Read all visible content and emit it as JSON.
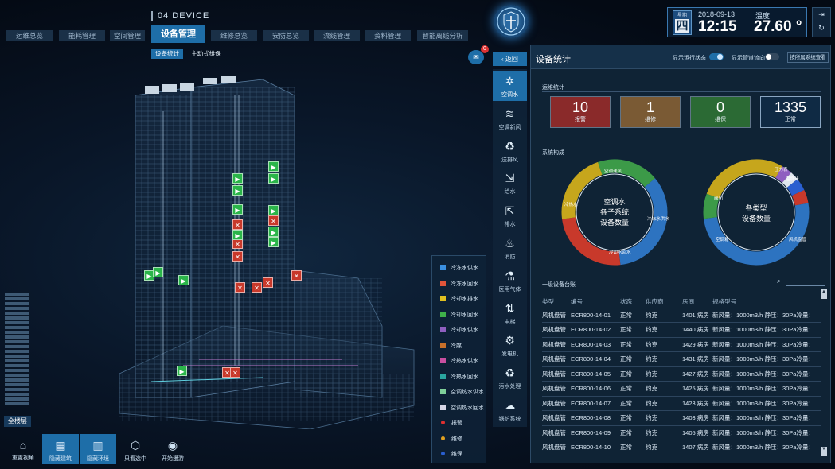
{
  "device_title": "04 DEVICE",
  "nav": [
    {
      "label": "运维总览",
      "active": false
    },
    {
      "label": "能耗管理",
      "active": false
    },
    {
      "label": "空间管理",
      "active": false
    },
    {
      "label": "设备管理",
      "active": true
    },
    {
      "label": "维修总览",
      "active": false
    },
    {
      "label": "安防总览",
      "active": false
    },
    {
      "label": "流线管理",
      "active": false
    },
    {
      "label": "资料管理",
      "active": false
    },
    {
      "label": "智能离线分析",
      "active": false
    }
  ],
  "subtabs": [
    {
      "label": "设备统计",
      "active": true
    },
    {
      "label": "主动式维保",
      "active": false
    }
  ],
  "datetime": {
    "week_label": "星期",
    "weekday": "四",
    "date": "2018-09-13",
    "time": "12:15",
    "temp_label": "温度",
    "temp": "27.60 °"
  },
  "chat_badge": "0",
  "all_floors_label": "全楼层",
  "toolbar": [
    {
      "label": "重置视角",
      "icon": "home-icon",
      "glyph": "⌂",
      "active": false
    },
    {
      "label": "隐藏建筑",
      "icon": "building-icon",
      "glyph": "▦",
      "active": true
    },
    {
      "label": "隐藏环境",
      "icon": "environment-icon",
      "glyph": "▥",
      "active": true
    },
    {
      "label": "只看选中",
      "icon": "cube-icon",
      "glyph": "⬡",
      "active": false
    },
    {
      "label": "开始漫游",
      "icon": "eye-icon",
      "glyph": "◉",
      "active": false
    }
  ],
  "legend": [
    {
      "label": "冷冻水供水",
      "color": "#3a8fe0",
      "shape": "square"
    },
    {
      "label": "冷冻水回水",
      "color": "#e0553a",
      "shape": "square"
    },
    {
      "label": "冷却水排水",
      "color": "#e0c020",
      "shape": "square"
    },
    {
      "label": "冷却水回水",
      "color": "#3fb04a",
      "shape": "square"
    },
    {
      "label": "冷却水供水",
      "color": "#8f5fc0",
      "shape": "square"
    },
    {
      "label": "冷媒",
      "color": "#c8702a",
      "shape": "square"
    },
    {
      "label": "冷热水供水",
      "color": "#c84fa0",
      "shape": "square"
    },
    {
      "label": "冷热水回水",
      "color": "#2aa6a0",
      "shape": "square"
    },
    {
      "label": "空调热水供水",
      "color": "#7fd09a",
      "shape": "square"
    },
    {
      "label": "空调热水回水",
      "color": "#d6d6e6",
      "shape": "square"
    },
    {
      "label": "报警",
      "color": "#e03030",
      "shape": "dot"
    },
    {
      "label": "维修",
      "color": "#e0a020",
      "shape": "dot"
    },
    {
      "label": "维保",
      "color": "#2a5fd0",
      "shape": "dot"
    }
  ],
  "back_label": "返回",
  "categories": [
    {
      "label": "空调水",
      "icon": "fan-icon",
      "glyph": "✲",
      "active": true
    },
    {
      "label": "空调新风",
      "icon": "wind-icon",
      "glyph": "≋",
      "active": false
    },
    {
      "label": "送排风",
      "icon": "recycle-icon",
      "glyph": "♻",
      "active": false
    },
    {
      "label": "给水",
      "icon": "water-in-icon",
      "glyph": "⇲",
      "active": false
    },
    {
      "label": "排水",
      "icon": "water-out-icon",
      "glyph": "⇱",
      "active": false
    },
    {
      "label": "消防",
      "icon": "fire-icon",
      "glyph": "♨",
      "active": false
    },
    {
      "label": "医用气体",
      "icon": "gas-icon",
      "glyph": "⚗",
      "active": false
    },
    {
      "label": "电梯",
      "icon": "elevator-icon",
      "glyph": "⇅",
      "active": false
    },
    {
      "label": "发电机",
      "icon": "generator-icon",
      "glyph": "⚙",
      "active": false
    },
    {
      "label": "污水处理",
      "icon": "sewage-icon",
      "glyph": "♻",
      "active": false
    },
    {
      "label": "锅炉系统",
      "icon": "boiler-icon",
      "glyph": "☁",
      "active": false
    }
  ],
  "panel": {
    "title": "设备统计",
    "toggle1": "显示运行状态",
    "toggle2": "显示管道流向",
    "link": "按所属系统查看",
    "ops_label": "运维统计",
    "stats": [
      {
        "num": "10",
        "label": "报警",
        "bg": "#8a2a2a"
      },
      {
        "num": "1",
        "label": "维修",
        "bg": "#7a5a34"
      },
      {
        "num": "0",
        "label": "维保",
        "bg": "#2b6a34"
      },
      {
        "num": "1335",
        "label": "正常",
        "bg": "#0f2a44"
      }
    ],
    "sys_label": "系统构成",
    "donut1": {
      "center": [
        "空调水",
        "各子系统",
        "设备数量"
      ],
      "labels": [
        "冷冻水供水",
        "冷却水回水",
        "冷热水",
        "空调送风"
      ]
    },
    "donut2": {
      "center": [
        "各类型",
        "设备数量"
      ],
      "labels": [
        "压力表",
        "温度计",
        "阀门",
        "空调箱",
        "风机盘管"
      ]
    },
    "table_label": "一级设备台账",
    "columns": [
      "类型",
      "编号",
      "状态",
      "供应商",
      "房间",
      "规格型号"
    ],
    "rows": [
      [
        "风机盘管",
        "ECR800-14-01",
        "正常",
        "约克",
        "1401 病房",
        "新风量：1000m3/h 静压：30Pa冷量："
      ],
      [
        "风机盘管",
        "ECR800-14-02",
        "正常",
        "约克",
        "1440 病房",
        "新风量：1000m3/h 静压：30Pa冷量："
      ],
      [
        "风机盘管",
        "ECR800-14-03",
        "正常",
        "约克",
        "1429 病房",
        "新风量：1000m3/h 静压：30Pa冷量："
      ],
      [
        "风机盘管",
        "ECR800-14-04",
        "正常",
        "约克",
        "1431 病房",
        "新风量：1000m3/h 静压：30Pa冷量："
      ],
      [
        "风机盘管",
        "ECR800-14-05",
        "正常",
        "约克",
        "1427 病房",
        "新风量：1000m3/h 静压：30Pa冷量："
      ],
      [
        "风机盘管",
        "ECR800-14-06",
        "正常",
        "约克",
        "1425 病房",
        "新风量：1000m3/h 静压：30Pa冷量："
      ],
      [
        "风机盘管",
        "ECR800-14-07",
        "正常",
        "约克",
        "1423 病房",
        "新风量：1000m3/h 静压：30Pa冷量："
      ],
      [
        "风机盘管",
        "ECR800-14-08",
        "正常",
        "约克",
        "1403 病房",
        "新风量：1000m3/h 静压：30Pa冷量："
      ],
      [
        "风机盘管",
        "ECR800-14-09",
        "正常",
        "约克",
        "1405 病房",
        "新风量：1000m3/h 静压：30Pa冷量："
      ],
      [
        "风机盘管",
        "ECR800-14-10",
        "正常",
        "约克",
        "1407 病房",
        "新风量：1000m3/h 静压：30Pa冷量："
      ]
    ]
  }
}
